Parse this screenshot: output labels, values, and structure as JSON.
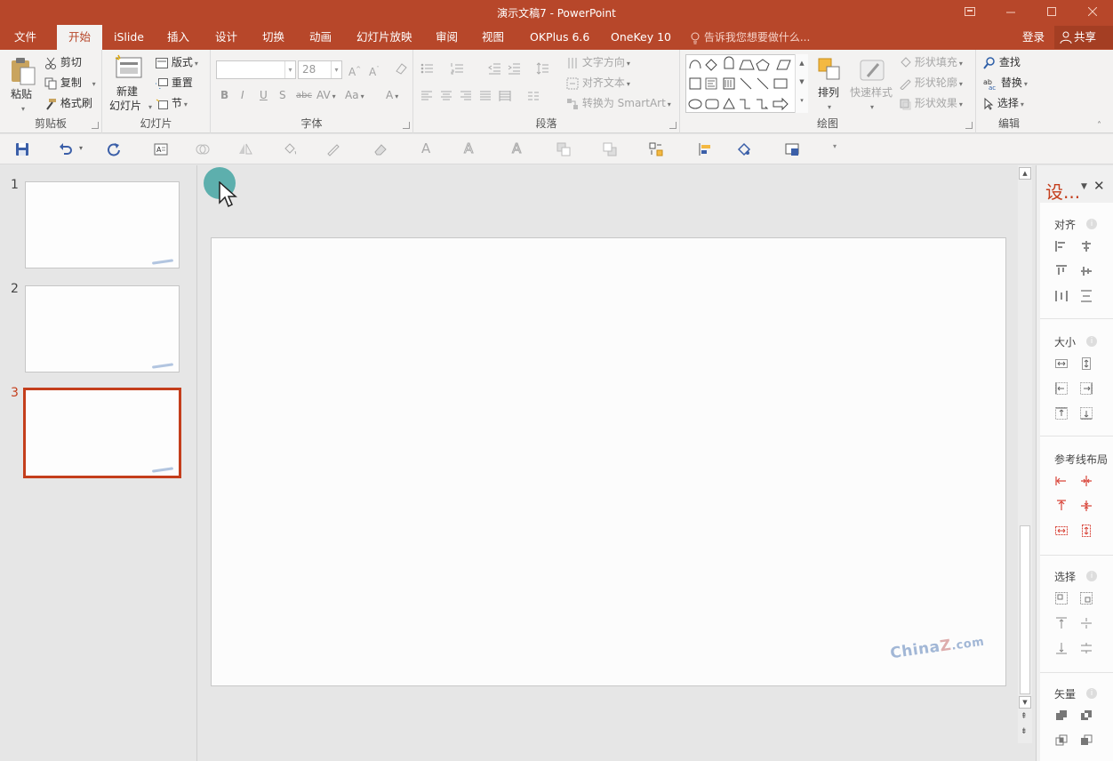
{
  "window": {
    "title": "演示文稿7 - PowerPoint",
    "controls": [
      "restore-ribbon",
      "minimize",
      "maximize",
      "close"
    ]
  },
  "tabs": [
    {
      "id": "file",
      "label": "文件"
    },
    {
      "id": "home",
      "label": "开始",
      "active": true
    },
    {
      "id": "islide",
      "label": "iSlide"
    },
    {
      "id": "insert",
      "label": "插入"
    },
    {
      "id": "design",
      "label": "设计"
    },
    {
      "id": "transitions",
      "label": "切换"
    },
    {
      "id": "animations",
      "label": "动画"
    },
    {
      "id": "slideshow",
      "label": "幻灯片放映"
    },
    {
      "id": "review",
      "label": "审阅"
    },
    {
      "id": "view",
      "label": "视图"
    },
    {
      "id": "okplus",
      "label": "OKPlus 6.6"
    },
    {
      "id": "onekey",
      "label": "OneKey 10"
    }
  ],
  "tell_me": "告诉我您想要做什么...",
  "account": {
    "login": "登录",
    "share": "共享"
  },
  "ribbon": {
    "clipboard": {
      "label": "剪贴板",
      "paste": "粘贴",
      "cut": "剪切",
      "copy": "复制",
      "format_painter": "格式刷"
    },
    "slides": {
      "label": "幻灯片",
      "new_slide_1": "新建",
      "new_slide_2": "幻灯片",
      "layout": "版式",
      "reset": "重置",
      "section": "节"
    },
    "font": {
      "label": "字体",
      "font_name": "",
      "font_size": "28",
      "bold": "B",
      "italic": "I",
      "underline": "U",
      "shadow": "S",
      "strike": "abc",
      "spacing": "AV",
      "case": "Aa",
      "color": "A"
    },
    "paragraph": {
      "label": "段落",
      "text_direction": "文字方向",
      "align_text": "对齐文本",
      "smartart": "转换为 SmartArt"
    },
    "drawing": {
      "label": "绘图",
      "arrange": "排列",
      "quick_styles": "快速样式",
      "shape_fill": "形状填充",
      "shape_outline": "形状轮廓",
      "shape_effects": "形状效果"
    },
    "editing": {
      "label": "编辑",
      "find": "查找",
      "replace": "替换",
      "select": "选择"
    }
  },
  "slides": [
    {
      "number": "1",
      "selected": false
    },
    {
      "number": "2",
      "selected": false
    },
    {
      "number": "3",
      "selected": true
    }
  ],
  "slide_watermark": {
    "prefix": "China",
    "z": "Z",
    "suffix": ".com"
  },
  "side_pane": {
    "title": "设...",
    "sections": [
      {
        "id": "align",
        "title": "对齐"
      },
      {
        "id": "size",
        "title": "大小"
      },
      {
        "id": "guides",
        "title": "参考线布局"
      },
      {
        "id": "select",
        "title": "选择"
      },
      {
        "id": "vector",
        "title": "矢量"
      }
    ]
  },
  "colors": {
    "accent": "#b7472a",
    "selection": "#c43e1c",
    "guide_icons": "#d9453a",
    "cursor_highlight": "#4ea9a6"
  }
}
